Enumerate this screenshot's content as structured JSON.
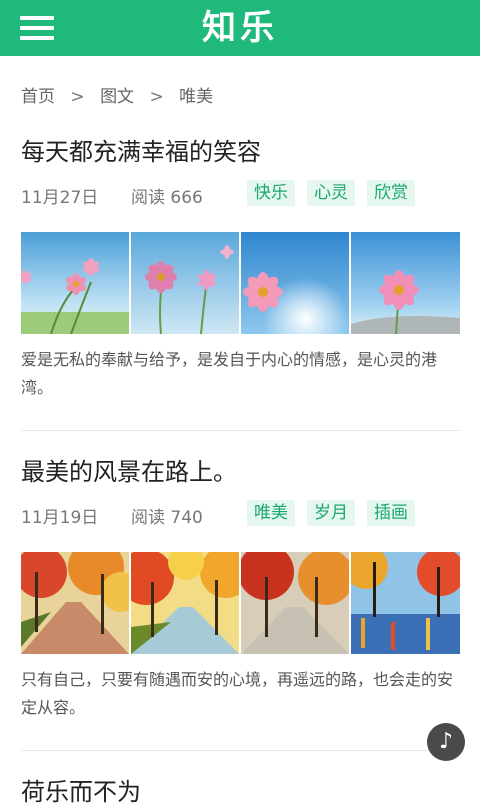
{
  "header": {
    "app_title": "知乐",
    "menu_icon": "hamburger-menu-icon"
  },
  "breadcrumb": {
    "items": [
      "首页",
      "图文",
      "唯美"
    ],
    "separator": ">"
  },
  "articles": [
    {
      "title": "每天都充满幸福的笑容",
      "date": "11月27日",
      "views": "阅读 666",
      "tags": [
        "快乐",
        "心灵",
        "欣赏"
      ],
      "images": [
        "cosmos-flower-photo",
        "cosmos-flower-photo",
        "cosmos-flower-photo",
        "cosmos-flower-photo"
      ],
      "description": "爱是无私的奉献与给予，是发自于内心的情感，是心灵的港湾。"
    },
    {
      "title": "最美的风景在路上。",
      "date": "11月19日",
      "views": "阅读 740",
      "tags": [
        "唯美",
        "岁月",
        "插画"
      ],
      "images": [
        "autumn-path-painting",
        "autumn-path-painting",
        "autumn-path-painting",
        "autumn-path-painting"
      ],
      "description": "只有自己，只要有随遇而安的心境，再遥远的路，也会走的安定从容。"
    },
    {
      "title": "荷乐而不为"
    }
  ],
  "music_button": {
    "icon": "music-note-icon",
    "glyph": "♪"
  },
  "colors": {
    "brand": "#1fb97c",
    "tag_bg": "#e6f7ef",
    "tag_text": "#1aa86e"
  }
}
